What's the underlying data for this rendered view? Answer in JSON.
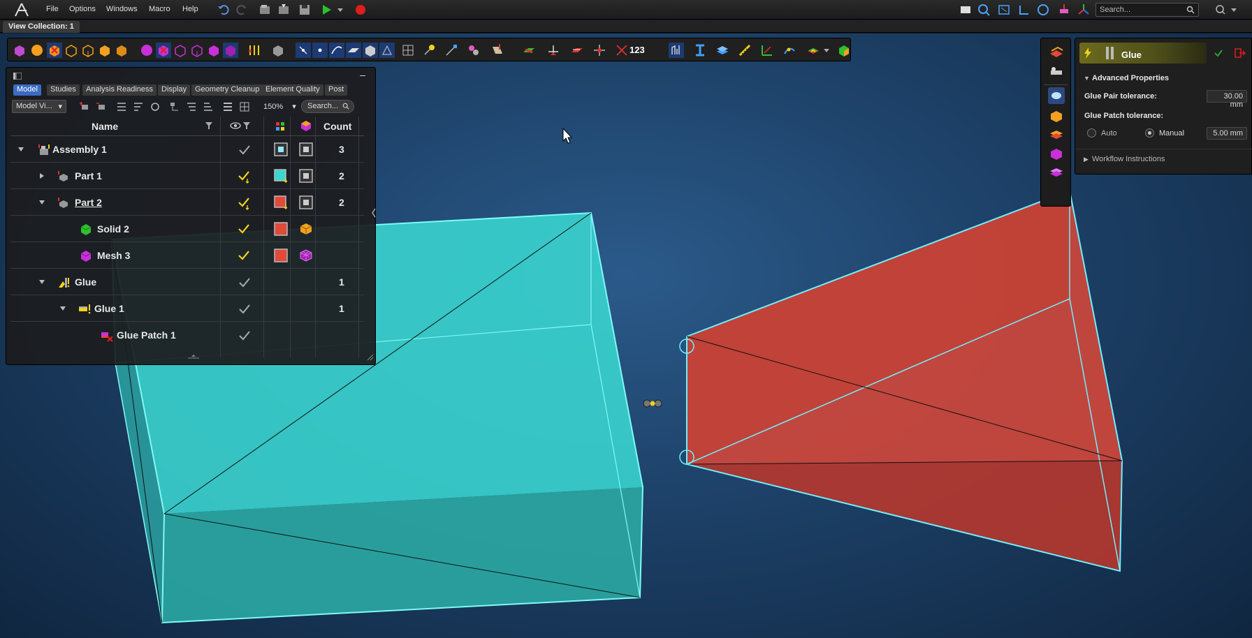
{
  "menubar": {
    "items": [
      "File",
      "Options",
      "Windows",
      "Macro",
      "Help"
    ],
    "search_placeholder": "Search..."
  },
  "tabs": {
    "view_collection": "View Collection: 1"
  },
  "ribbon": {
    "number_tool": "123"
  },
  "browser": {
    "tabs": [
      "Model",
      "Studies",
      "Analysis Readiness",
      "Display",
      "Geometry Cleanup",
      "Element Quality",
      "Post"
    ],
    "active_tab": "Model",
    "view_select": "Model Vi...",
    "zoom": "150%",
    "search_placeholder": "Search...",
    "columns": {
      "name": "Name",
      "count": "Count"
    },
    "rows": [
      {
        "label": "Assembly 1",
        "count": "3"
      },
      {
        "label": "Part 1",
        "count": "2"
      },
      {
        "label": "Part 2",
        "count": "2"
      },
      {
        "label": "Solid 2",
        "count": ""
      },
      {
        "label": "Mesh 3",
        "count": ""
      },
      {
        "label": "Glue",
        "count": "1"
      },
      {
        "label": "Glue 1",
        "count": "1"
      },
      {
        "label": "Glue Patch 1",
        "count": ""
      }
    ]
  },
  "glue_panel": {
    "title": "Glue",
    "section": "Advanced Properties",
    "pair_tolerance_label": "Glue Pair tolerance:",
    "pair_tolerance_value": "30.00 mm",
    "patch_tolerance_label": "Glue Patch tolerance:",
    "auto_label": "Auto",
    "manual_label": "Manual",
    "patch_tolerance_value": "5.00 mm",
    "workflow": "Workflow Instructions",
    "selected_mode": "Manual"
  },
  "colors": {
    "cyan_body": "#3ad6d0",
    "red_body": "#d2473a",
    "accent_blue": "#3b6bc4",
    "glue_yellow": "#6b6a1e"
  }
}
